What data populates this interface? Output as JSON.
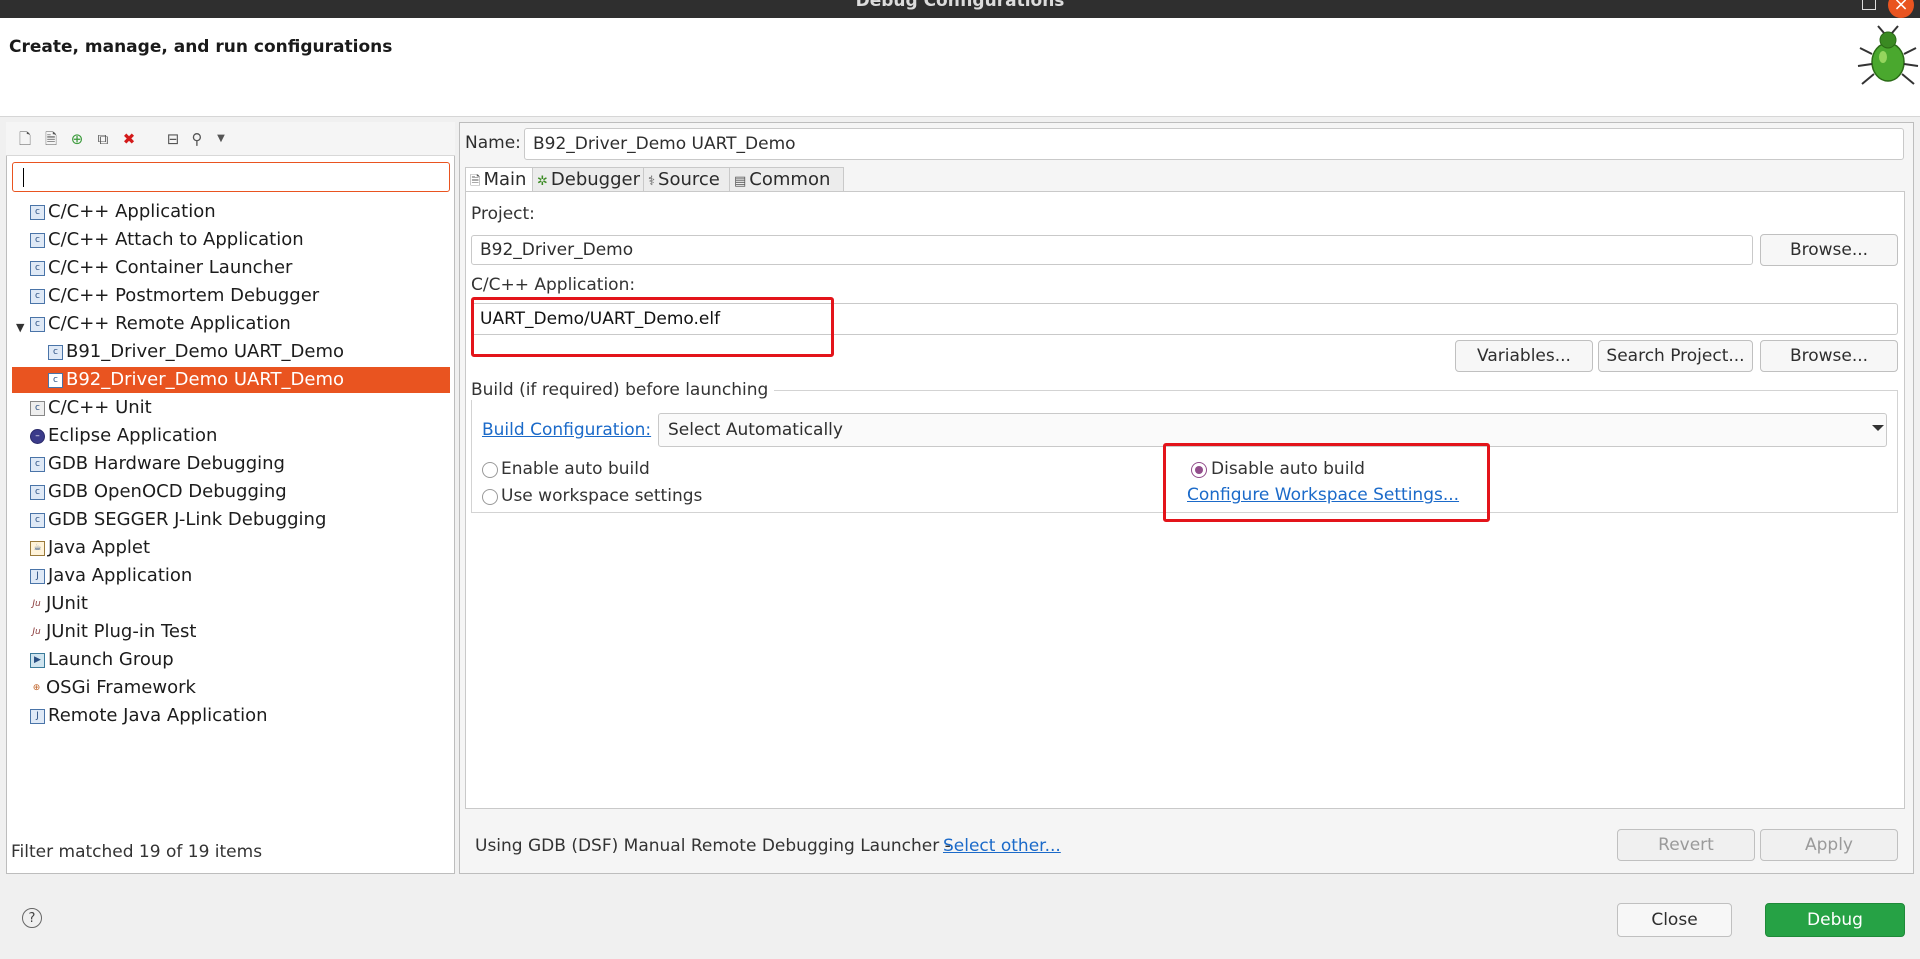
{
  "window": {
    "title": "Debug Configurations"
  },
  "header": {
    "title": "Create, manage, and run configurations"
  },
  "toolbar": {
    "icons": [
      "new-config-icon",
      "new-prototype-icon",
      "export-icon",
      "duplicate-icon",
      "delete-icon",
      "collapse-all-icon",
      "filter-icon",
      "view-menu-icon"
    ]
  },
  "filter": {
    "value": "",
    "placeholder": ""
  },
  "tree": {
    "items": [
      {
        "label": "C/C++ Application"
      },
      {
        "label": "C/C++ Attach to Application"
      },
      {
        "label": "C/C++ Container Launcher"
      },
      {
        "label": "C/C++ Postmortem Debugger"
      },
      {
        "label": "C/C++ Remote Application"
      },
      {
        "label": "B91_Driver_Demo UART_Demo"
      },
      {
        "label": "B92_Driver_Demo UART_Demo"
      },
      {
        "label": "C/C++ Unit"
      },
      {
        "label": "Eclipse Application"
      },
      {
        "label": "GDB Hardware Debugging"
      },
      {
        "label": "GDB OpenOCD Debugging"
      },
      {
        "label": "GDB SEGGER J-Link Debugging"
      },
      {
        "label": "Java Applet"
      },
      {
        "label": "Java Application"
      },
      {
        "label": "JUnit"
      },
      {
        "label": "JUnit Plug-in Test"
      },
      {
        "label": "Launch Group"
      },
      {
        "label": "OSGi Framework"
      },
      {
        "label": "Remote Java Application"
      }
    ],
    "status": "Filter matched 19 of 19 items"
  },
  "config": {
    "name_label": "Name:",
    "name_value": "B92_Driver_Demo UART_Demo",
    "tabs": [
      {
        "label": "Main",
        "icon": "main-tab-icon"
      },
      {
        "label": "Debugger",
        "icon": "debugger-tab-icon"
      },
      {
        "label": "Source",
        "icon": "source-tab-icon"
      },
      {
        "label": "Common",
        "icon": "common-tab-icon"
      }
    ],
    "project_label": "Project:",
    "project_value": "B92_Driver_Demo",
    "browse_label": "Browse...",
    "app_label": "C/C++ Application:",
    "app_value": "UART_Demo/UART_Demo.elf",
    "variables_label": "Variables...",
    "search_project_label": "Search Project...",
    "build": {
      "group_label": "Build (if required) before launching",
      "config_link": "Build Configuration:",
      "config_value": "Select Automatically",
      "enable_auto": "Enable auto build",
      "disable_auto": "Disable auto build",
      "use_workspace": "Use workspace settings",
      "configure_link": "Configure Workspace Settings...",
      "selected": "disable_auto"
    },
    "launcher_text": "Using GDB (DSF) Manual Remote Debugging Launcher - ",
    "select_other": "Select other...",
    "revert_label": "Revert",
    "apply_label": "Apply"
  },
  "footer": {
    "help": "?",
    "close_label": "Close",
    "debug_label": "Debug"
  },
  "colors": {
    "accent": "#e95420",
    "debug_button": "#26a245",
    "link": "#1b6ac9",
    "highlight_box": "#e3141a"
  }
}
